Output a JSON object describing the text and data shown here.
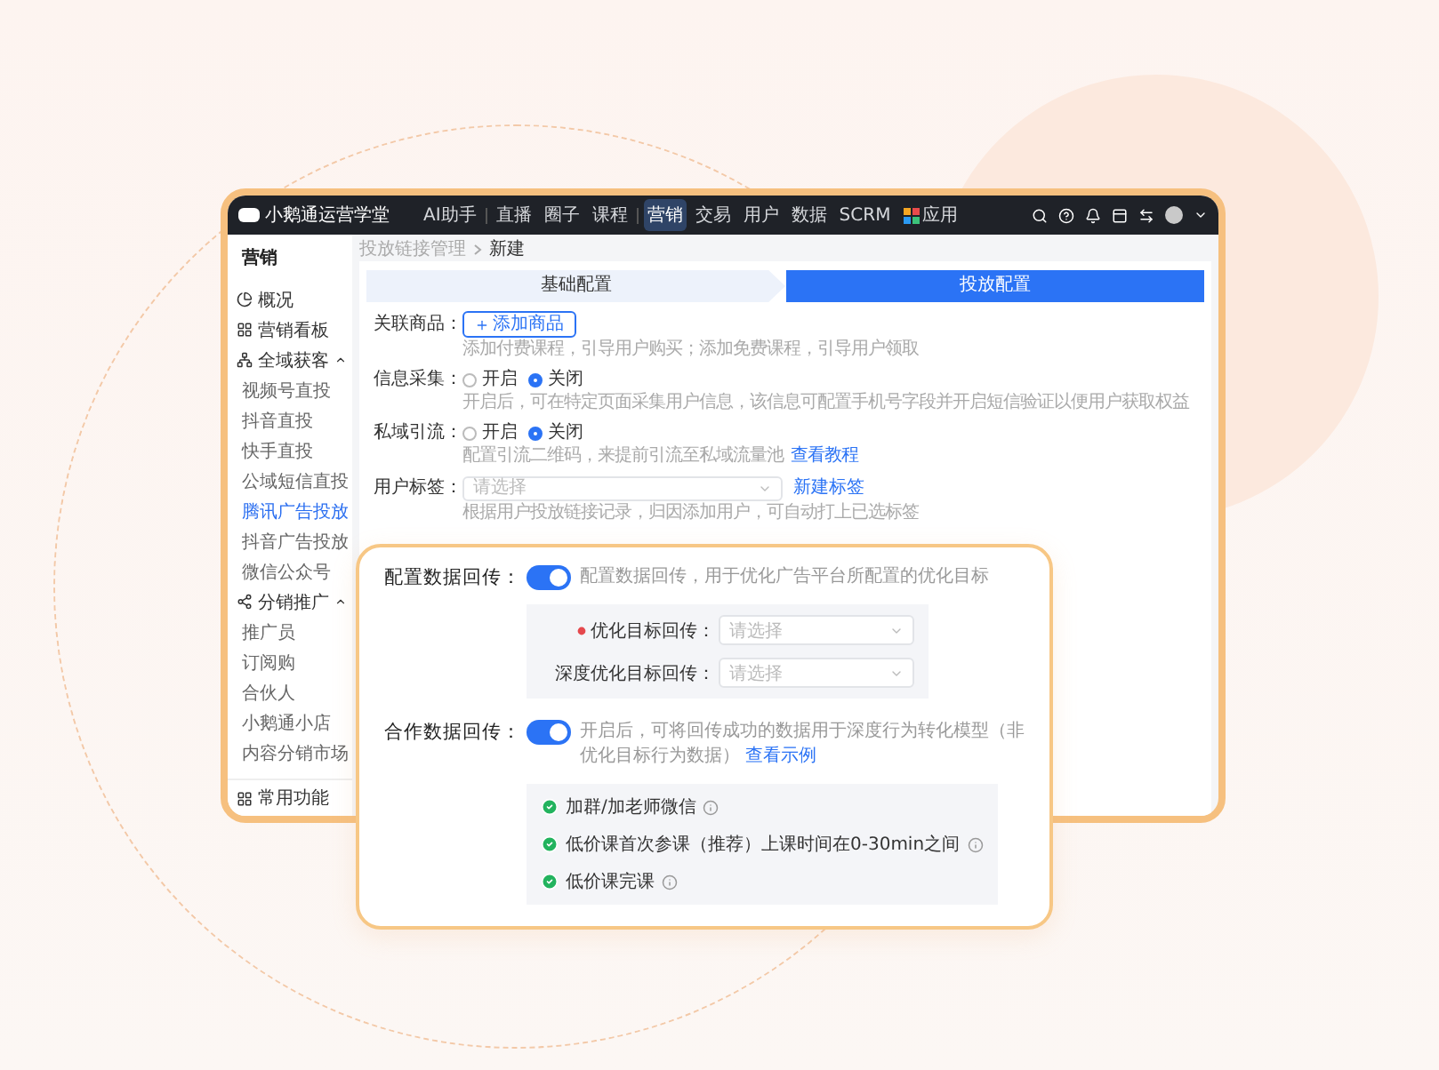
{
  "app": {
    "brand": "小鹅通运营学堂"
  },
  "nav": [
    {
      "label": "AI助手",
      "selected": false
    },
    {
      "label": "直播",
      "selected": false
    },
    {
      "label": "圈子",
      "selected": false
    },
    {
      "label": "课程",
      "selected": false
    },
    {
      "label": "营销",
      "selected": true
    },
    {
      "label": "交易",
      "selected": false
    },
    {
      "label": "用户",
      "selected": false
    },
    {
      "label": "数据",
      "selected": false
    },
    {
      "label": "SCRM",
      "selected": false
    },
    {
      "label": "应用",
      "selected": false
    }
  ],
  "sidebar": {
    "title": "营销",
    "items": [
      {
        "label": "概况",
        "selected": false
      },
      {
        "label": "营销看板",
        "selected": false
      },
      {
        "label": "全域获客",
        "selected": false,
        "expanded": true,
        "children": [
          {
            "label": "视频号直投",
            "selected": false
          },
          {
            "label": "抖音直投",
            "selected": false
          },
          {
            "label": "快手直投",
            "selected": false
          },
          {
            "label": "公域短信直投",
            "selected": false
          },
          {
            "label": "腾讯广告投放",
            "selected": true
          },
          {
            "label": "抖音广告投放",
            "selected": false
          },
          {
            "label": "微信公众号",
            "selected": false
          }
        ]
      },
      {
        "label": "分销推广",
        "selected": false,
        "expanded": true,
        "children": [
          {
            "label": "推广员",
            "selected": false
          },
          {
            "label": "订阅购",
            "selected": false
          },
          {
            "label": "合伙人",
            "selected": false
          },
          {
            "label": "小鹅通小店",
            "selected": false
          },
          {
            "label": "内容分销市场",
            "selected": false
          }
        ]
      }
    ],
    "footer": "常用功能"
  },
  "breadcrumb": [
    "投放链接管理",
    "新建"
  ],
  "steps": [
    {
      "label": "基础配置",
      "selected": false
    },
    {
      "label": "投放配置",
      "selected": true
    }
  ],
  "form": {
    "rows": [
      {
        "kind": "button",
        "label": "关联商品：",
        "button": "添加商品",
        "hint": "添加付费课程，引导用户购买；添加免费课程，引导用户领取"
      },
      {
        "kind": "radio",
        "label": "信息采集：",
        "options": [
          {
            "label": "开启",
            "selected": false
          },
          {
            "label": "关闭",
            "selected": true
          }
        ],
        "hint": "开启后，可在特定页面采集用户信息，该信息可配置手机号字段并开启短信验证以便用户获取权益"
      },
      {
        "kind": "radio",
        "label": "私域引流：",
        "options": [
          {
            "label": "开启",
            "selected": false
          },
          {
            "label": "关闭",
            "selected": true
          }
        ],
        "hint": "配置引流二维码，来提前引流至私域流量池",
        "link": "查看教程"
      },
      {
        "kind": "select",
        "label": "用户标签：",
        "placeholder": "请选择",
        "link": "新建标签",
        "hint": "根据用户投放链接记录，归因添加用户，可自动打上已选标签"
      }
    ]
  },
  "callout": {
    "sections": [
      {
        "label": "配置数据回传：",
        "on": true,
        "description": "配置数据回传，用于优化广告平台所配置的优化目标",
        "fields": [
          {
            "label": "优化目标回传：",
            "required": true,
            "placeholder": "请选择"
          },
          {
            "label": "深度优化目标回传：",
            "required": false,
            "placeholder": "请选择"
          }
        ]
      },
      {
        "label": "合作数据回传：",
        "on": true,
        "description": "开启后，可将回传成功的数据用于深度行为转化模型（非优化目标行为数据）",
        "link": "查看示例",
        "checks": [
          {
            "label": "加群/加老师微信",
            "checked": true
          },
          {
            "label": "低价课首次参课（推荐）上课时间在0-30min之间",
            "checked": true
          },
          {
            "label": "低价课完课",
            "checked": true
          }
        ]
      }
    ]
  }
}
